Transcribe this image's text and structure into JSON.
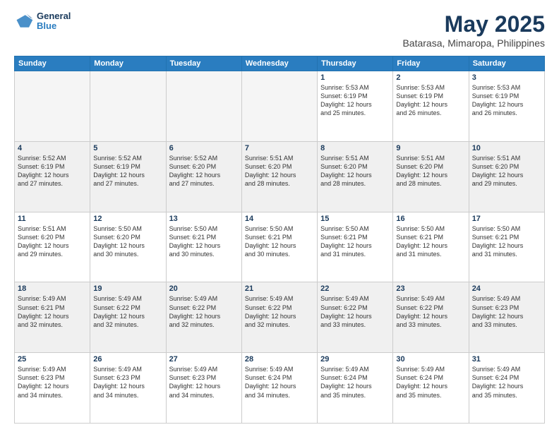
{
  "logo": {
    "line1": "General",
    "line2": "Blue"
  },
  "title": "May 2025",
  "subtitle": "Batarasa, Mimaropa, Philippines",
  "days_of_week": [
    "Sunday",
    "Monday",
    "Tuesday",
    "Wednesday",
    "Thursday",
    "Friday",
    "Saturday"
  ],
  "weeks": [
    [
      {
        "day": "",
        "info": "",
        "empty": true
      },
      {
        "day": "",
        "info": "",
        "empty": true
      },
      {
        "day": "",
        "info": "",
        "empty": true
      },
      {
        "day": "",
        "info": "",
        "empty": true
      },
      {
        "day": "1",
        "info": "Sunrise: 5:53 AM\nSunset: 6:19 PM\nDaylight: 12 hours\nand 25 minutes.",
        "empty": false
      },
      {
        "day": "2",
        "info": "Sunrise: 5:53 AM\nSunset: 6:19 PM\nDaylight: 12 hours\nand 26 minutes.",
        "empty": false
      },
      {
        "day": "3",
        "info": "Sunrise: 5:53 AM\nSunset: 6:19 PM\nDaylight: 12 hours\nand 26 minutes.",
        "empty": false
      }
    ],
    [
      {
        "day": "4",
        "info": "Sunrise: 5:52 AM\nSunset: 6:19 PM\nDaylight: 12 hours\nand 27 minutes.",
        "empty": false
      },
      {
        "day": "5",
        "info": "Sunrise: 5:52 AM\nSunset: 6:19 PM\nDaylight: 12 hours\nand 27 minutes.",
        "empty": false
      },
      {
        "day": "6",
        "info": "Sunrise: 5:52 AM\nSunset: 6:20 PM\nDaylight: 12 hours\nand 27 minutes.",
        "empty": false
      },
      {
        "day": "7",
        "info": "Sunrise: 5:51 AM\nSunset: 6:20 PM\nDaylight: 12 hours\nand 28 minutes.",
        "empty": false
      },
      {
        "day": "8",
        "info": "Sunrise: 5:51 AM\nSunset: 6:20 PM\nDaylight: 12 hours\nand 28 minutes.",
        "empty": false
      },
      {
        "day": "9",
        "info": "Sunrise: 5:51 AM\nSunset: 6:20 PM\nDaylight: 12 hours\nand 28 minutes.",
        "empty": false
      },
      {
        "day": "10",
        "info": "Sunrise: 5:51 AM\nSunset: 6:20 PM\nDaylight: 12 hours\nand 29 minutes.",
        "empty": false
      }
    ],
    [
      {
        "day": "11",
        "info": "Sunrise: 5:51 AM\nSunset: 6:20 PM\nDaylight: 12 hours\nand 29 minutes.",
        "empty": false
      },
      {
        "day": "12",
        "info": "Sunrise: 5:50 AM\nSunset: 6:20 PM\nDaylight: 12 hours\nand 30 minutes.",
        "empty": false
      },
      {
        "day": "13",
        "info": "Sunrise: 5:50 AM\nSunset: 6:21 PM\nDaylight: 12 hours\nand 30 minutes.",
        "empty": false
      },
      {
        "day": "14",
        "info": "Sunrise: 5:50 AM\nSunset: 6:21 PM\nDaylight: 12 hours\nand 30 minutes.",
        "empty": false
      },
      {
        "day": "15",
        "info": "Sunrise: 5:50 AM\nSunset: 6:21 PM\nDaylight: 12 hours\nand 31 minutes.",
        "empty": false
      },
      {
        "day": "16",
        "info": "Sunrise: 5:50 AM\nSunset: 6:21 PM\nDaylight: 12 hours\nand 31 minutes.",
        "empty": false
      },
      {
        "day": "17",
        "info": "Sunrise: 5:50 AM\nSunset: 6:21 PM\nDaylight: 12 hours\nand 31 minutes.",
        "empty": false
      }
    ],
    [
      {
        "day": "18",
        "info": "Sunrise: 5:49 AM\nSunset: 6:21 PM\nDaylight: 12 hours\nand 32 minutes.",
        "empty": false
      },
      {
        "day": "19",
        "info": "Sunrise: 5:49 AM\nSunset: 6:22 PM\nDaylight: 12 hours\nand 32 minutes.",
        "empty": false
      },
      {
        "day": "20",
        "info": "Sunrise: 5:49 AM\nSunset: 6:22 PM\nDaylight: 12 hours\nand 32 minutes.",
        "empty": false
      },
      {
        "day": "21",
        "info": "Sunrise: 5:49 AM\nSunset: 6:22 PM\nDaylight: 12 hours\nand 32 minutes.",
        "empty": false
      },
      {
        "day": "22",
        "info": "Sunrise: 5:49 AM\nSunset: 6:22 PM\nDaylight: 12 hours\nand 33 minutes.",
        "empty": false
      },
      {
        "day": "23",
        "info": "Sunrise: 5:49 AM\nSunset: 6:22 PM\nDaylight: 12 hours\nand 33 minutes.",
        "empty": false
      },
      {
        "day": "24",
        "info": "Sunrise: 5:49 AM\nSunset: 6:23 PM\nDaylight: 12 hours\nand 33 minutes.",
        "empty": false
      }
    ],
    [
      {
        "day": "25",
        "info": "Sunrise: 5:49 AM\nSunset: 6:23 PM\nDaylight: 12 hours\nand 34 minutes.",
        "empty": false
      },
      {
        "day": "26",
        "info": "Sunrise: 5:49 AM\nSunset: 6:23 PM\nDaylight: 12 hours\nand 34 minutes.",
        "empty": false
      },
      {
        "day": "27",
        "info": "Sunrise: 5:49 AM\nSunset: 6:23 PM\nDaylight: 12 hours\nand 34 minutes.",
        "empty": false
      },
      {
        "day": "28",
        "info": "Sunrise: 5:49 AM\nSunset: 6:24 PM\nDaylight: 12 hours\nand 34 minutes.",
        "empty": false
      },
      {
        "day": "29",
        "info": "Sunrise: 5:49 AM\nSunset: 6:24 PM\nDaylight: 12 hours\nand 35 minutes.",
        "empty": false
      },
      {
        "day": "30",
        "info": "Sunrise: 5:49 AM\nSunset: 6:24 PM\nDaylight: 12 hours\nand 35 minutes.",
        "empty": false
      },
      {
        "day": "31",
        "info": "Sunrise: 5:49 AM\nSunset: 6:24 PM\nDaylight: 12 hours\nand 35 minutes.",
        "empty": false
      }
    ]
  ]
}
